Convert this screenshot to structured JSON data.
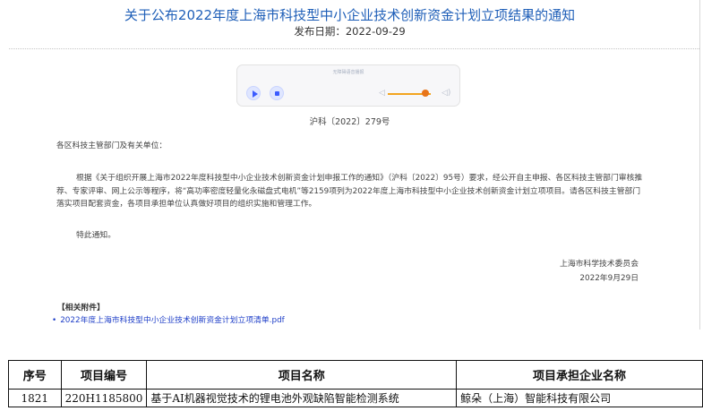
{
  "notice": {
    "title": "关于公布2022年度上海市科技型中小企业技术创新资金计划立项结果的通知",
    "date_label": "发布日期：",
    "date_value": "2022-09-29",
    "player": {
      "hint": "无障碍语音播报"
    },
    "doc_number": "沪科〔2022〕279号",
    "addressee": "各区科技主管部门及有关单位：",
    "body": "根据《关于组织开展上海市2022年度科技型中小企业技术创新资金计划申报工作的通知》（沪科〔2022〕95号）要求，经公开自主申报、各区科技主管部门审核推荐、专家评审、网上公示等程序，将“高功率密度轻量化永磁盘式电机”等2159项列为2022年度上海市科技型中小企业技术创新资金计划立项项目。请各区科技主管部门落实项目配套资金，各项目承担单位认真做好项目的组织实施和管理工作。",
    "closing": "特此通知。",
    "sign_org": "上海市科学技术委员会",
    "sign_date": "2022年9月29日",
    "attachments_heading": "【相关附件】",
    "attachment_link": "2022年度上海市科技型中小企业技术创新资金计划立项清单.pdf"
  },
  "table": {
    "headers": [
      "序号",
      "项目编号",
      "项目名称",
      "项目承担企业名称"
    ],
    "rows": [
      [
        "1821",
        "220H1185800",
        "基于AI机器视觉技术的锂电池外观缺陷智能检测系统",
        "鲸朵（上海）智能科技有限公司"
      ]
    ]
  },
  "colors": {
    "title": "#1f5fb8",
    "link": "#1f3fc8",
    "player_accent": "#e8751a"
  }
}
